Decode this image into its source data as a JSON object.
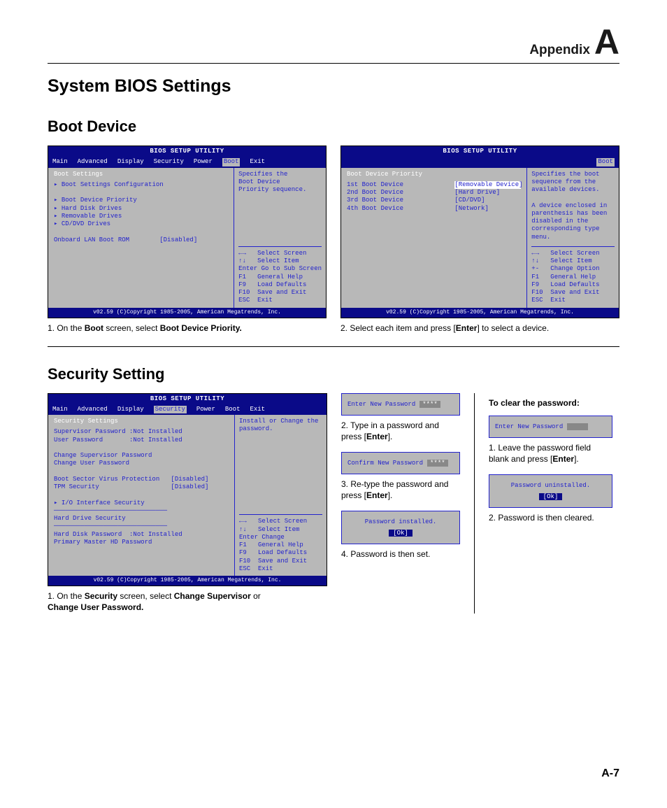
{
  "header": {
    "appendix": "Appendix",
    "letter": "A"
  },
  "page_title": "System BIOS Settings",
  "page_number": "A-7",
  "boot": {
    "heading": "Boot Device",
    "shot1": {
      "title": "BIOS SETUP UTILITY",
      "menus": [
        "Main",
        "Advanced",
        "Display",
        "Security",
        "Power",
        "Boot",
        "Exit"
      ],
      "sel_index": 5,
      "left_title": "Boot Settings",
      "items": [
        "▸ Boot Settings Configuration",
        "",
        "▸ Boot Device Priority",
        "▸ Hard Disk Drives",
        "▸ Removable Drives",
        "▸ CD/DVD Drives",
        "",
        "Onboard LAN Boot ROM        [Disabled]"
      ],
      "right_desc": "Specifies the\nBoot Device\nPriority sequence.",
      "help": [
        "←→   Select Screen",
        "↑↓   Select Item",
        "Enter Go to Sub Screen",
        "F1   General Help",
        "F9   Load Defaults",
        "F10  Save and Exit",
        "ESC  Exit"
      ],
      "footer": "v02.59 (C)Copyright 1985-2005, American Megatrends, Inc.",
      "caption_pre": "1. On the ",
      "caption_b1": "Boot",
      "caption_mid": " screen, select ",
      "caption_b2": "Boot Device Priority."
    },
    "shot2": {
      "title": "BIOS SETUP UTILITY",
      "menu_single": "Boot",
      "left_title": "Boot Device Priority",
      "rows": [
        {
          "k": "1st Boot Device",
          "v": "[Removable Device]",
          "sel": true
        },
        {
          "k": "2nd Boot Device",
          "v": "[Hard Drive]"
        },
        {
          "k": "3rd Boot Device",
          "v": "[CD/DVD]"
        },
        {
          "k": "4th Boot Device",
          "v": "[Network]"
        }
      ],
      "right_desc": "Specifies the boot\nsequence from the\navailable devices.\n\nA device enclosed in\nparenthesis has been\ndisabled in the\ncorresponding type\nmenu.",
      "help": [
        "←→   Select Screen",
        "↑↓   Select Item",
        "+-   Change Option",
        "F1   General Help",
        "F9   Load Defaults",
        "F10  Save and Exit",
        "ESC  Exit"
      ],
      "footer": "v02.59 (C)Copyright 1985-2005, American Megatrends, Inc.",
      "caption_pre": "2. Select each item and press [",
      "caption_b": "Enter",
      "caption_post": "] to select a device."
    }
  },
  "security": {
    "heading": "Security Setting",
    "shot": {
      "title": "BIOS SETUP UTILITY",
      "menus": [
        "Main",
        "Advanced",
        "Display",
        "Security",
        "Power",
        "Boot",
        "Exit"
      ],
      "sel_index": 3,
      "left_title": "Security Settings",
      "lines": [
        "Supervisor Password :Not Installed",
        "User Password       :Not Installed",
        "",
        "Change Supervisor Password",
        "Change User Password",
        "",
        "Boot Sector Virus Protection   [Disabled]",
        "TPM Security                   [Disabled]",
        "",
        "▸ I/O Interface Security",
        "──────────────────────────────",
        "Hard Drive Security",
        "──────────────────────────────",
        "Hard Disk Password  :Not Installed",
        "Primary Master HD Password"
      ],
      "right_desc": "Install or Change the\npassword.",
      "help": [
        "←→   Select Screen",
        "↑↓   Select Item",
        "Enter Change",
        "F1   General Help",
        "F9   Load Defaults",
        "F10  Save and Exit",
        "ESC  Exit"
      ],
      "footer": "v02.59 (C)Copyright 1985-2005, American Megatrends, Inc.",
      "cap_pre": "1. On the ",
      "cap_b1": "Security",
      "cap_mid": " screen, select ",
      "cap_b2": "Change Supervisor",
      "cap_or": " or ",
      "cap_b3": "Change User Password."
    },
    "mid": {
      "box1_label": "Enter New Password",
      "box1_val": "****",
      "cap2_pre": "2. Type in a password and press [",
      "cap2_b": "Enter",
      "cap2_post": "].",
      "box2_label": "Confirm New Password",
      "box2_val": "****",
      "cap3_pre": "3. Re-type the password and press [",
      "cap3_b": "Enter",
      "cap3_post": "].",
      "box3_label": "Password installed.",
      "box3_ok": "[Ok]",
      "cap4": "4. Password is then set."
    },
    "right": {
      "clear_heading": "To clear the password:",
      "box1_label": "Enter New Password",
      "cap1_pre": "1. Leave the password field blank and press [",
      "cap1_b": "Enter",
      "cap1_post": "].",
      "box2_label": "Password uninstalled.",
      "box2_ok": "[Ok]",
      "cap2": "2. Password is then cleared."
    }
  }
}
